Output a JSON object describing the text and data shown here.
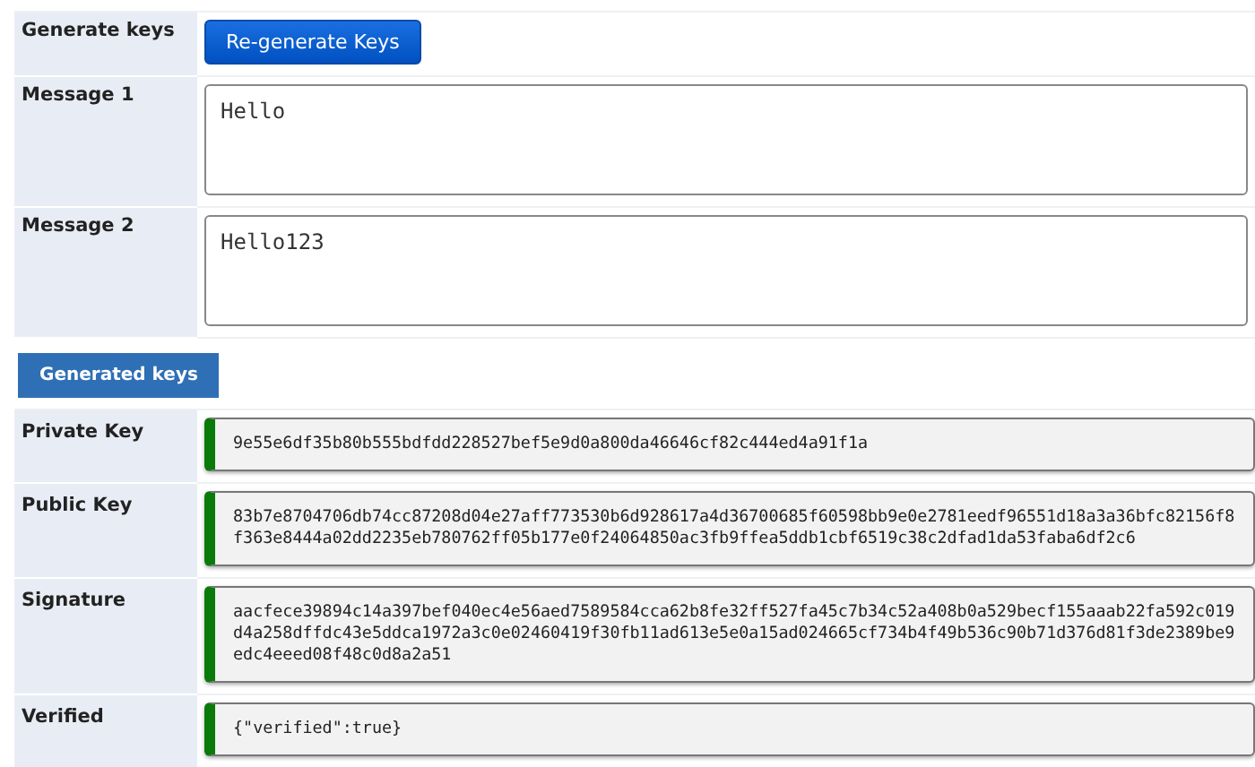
{
  "form_rows": [
    {
      "label": "Generate keys",
      "kind": "button",
      "button": "Re-generate Keys"
    },
    {
      "label": "Message 1",
      "kind": "textarea",
      "value": "Hello"
    },
    {
      "label": "Message 2",
      "kind": "textarea",
      "value": "Hello123"
    }
  ],
  "section_button": "Generated keys",
  "results": [
    {
      "label": "Private Key",
      "value": "9e55e6df35b80b555bdfdd228527bef5e9d0a800da46646cf82c444ed4a91f1a"
    },
    {
      "label": "Public Key",
      "value": "83b7e8704706db74cc87208d04e27aff773530b6d928617a4d36700685f60598bb9e0e2781eedf96551d18a3a36bfc82156f8f363e8444a02dd2235eb780762ff05b177e0f24064850ac3fb9ffea5ddb1cbf6519c38c2dfad1da53faba6df2c6"
    },
    {
      "label": "Signature",
      "value": "aacfece39894c14a397bef040ec4e56aed7589584cca62b8fe32ff527fa45c7b34c52a408b0a529becf155aaab22fa592c019d4a258dffdc43e5ddca1972a3c0e02460419f30fb11ad613e5e0a15ad024665cf734b4f49b536c90b71d376d81f3de2389be9edc4eeed08f48c0d8a2a51"
    },
    {
      "label": "Verified",
      "value": "{\"verified\":true}"
    }
  ]
}
